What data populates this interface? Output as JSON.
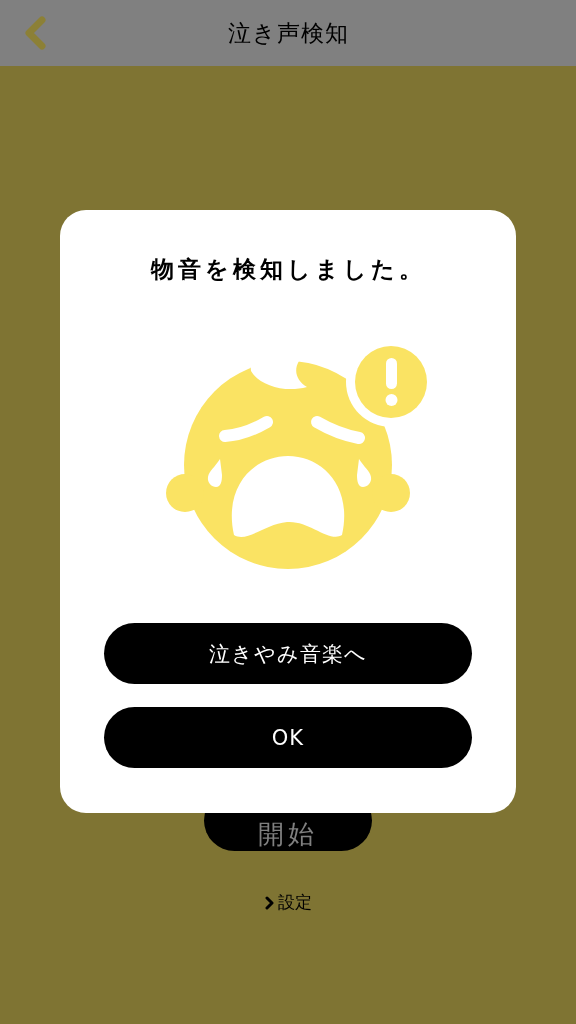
{
  "header": {
    "title": "泣き声検知"
  },
  "start_button": {
    "label": "開始"
  },
  "settings_link": {
    "label": "設定"
  },
  "dialog": {
    "title": "物音を検知しました。",
    "buttons": [
      {
        "label": "泣きやみ音楽へ"
      },
      {
        "label": "OK"
      }
    ]
  }
}
